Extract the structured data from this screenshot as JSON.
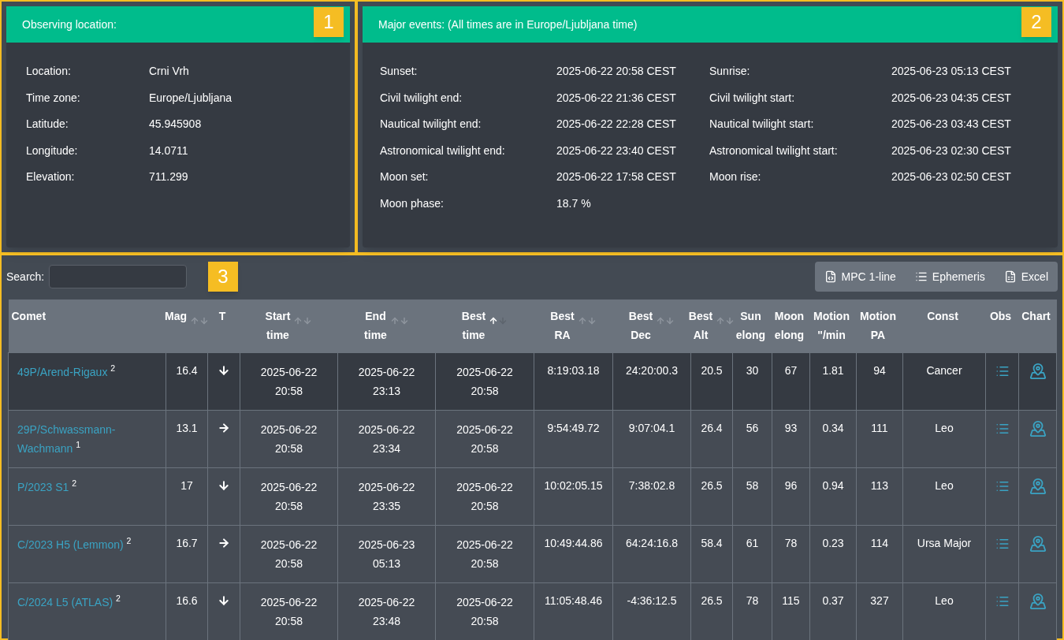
{
  "location_panel": {
    "title": "Observing location:",
    "badge": "1",
    "fields": [
      {
        "label": "Location:",
        "value": "Crni Vrh"
      },
      {
        "label": "Time zone:",
        "value": "Europe/Ljubljana"
      },
      {
        "label": "Latitude:",
        "value": "45.945908"
      },
      {
        "label": "Longitude:",
        "value": "14.0711"
      },
      {
        "label": "Elevation:",
        "value": "711.299"
      }
    ]
  },
  "events_panel": {
    "title": "Major events: (All times are in Europe/Ljubljana time)",
    "badge": "2",
    "rows": [
      {
        "label": "Sunset:",
        "value": "2025-06-22 20:58 CEST",
        "label_2": "Sunrise:",
        "value_2": "2025-06-23 05:13 CEST"
      },
      {
        "label": "Civil twilight end:",
        "value": "2025-06-22 21:36 CEST",
        "label_2": "Civil twilight start:",
        "value_2": "2025-06-23 04:35 CEST"
      },
      {
        "label": "Nautical twilight end:",
        "value": "2025-06-22 22:28 CEST",
        "label_2": "Nautical twilight start:",
        "value_2": "2025-06-23 03:43 CEST"
      },
      {
        "label": "Astronomical twilight end:",
        "value": "2025-06-22 23:40 CEST",
        "label_2": "Astronomical twilight start:",
        "value_2": "2025-06-23 02:30 CEST"
      },
      {
        "label": "Moon set:",
        "value": "2025-06-22 17:58 CEST",
        "label_2": "Moon rise:",
        "value_2": "2025-06-23 02:50 CEST"
      },
      {
        "label": "Moon phase:",
        "value": "18.7 %"
      }
    ]
  },
  "table_panel": {
    "badge": "3",
    "search": {
      "label": "Search:"
    },
    "exports": [
      {
        "kind": "code",
        "label": "MPC 1-line"
      },
      {
        "kind": "list",
        "label": "Ephemeris"
      },
      {
        "kind": "excel",
        "label": "Excel"
      }
    ],
    "columns": [
      {
        "label": "Comet"
      },
      {
        "label": "Mag",
        "sorted": false
      },
      {
        "label": "T"
      },
      {
        "label": "Start time",
        "sorted": false
      },
      {
        "label": "End time",
        "sorted": false
      },
      {
        "label": "Best time",
        "sorted": true
      },
      {
        "label": "Best RA",
        "sorted": false
      },
      {
        "label": "Best Dec",
        "sorted": false
      },
      {
        "label": "Best Alt",
        "sorted": false
      },
      {
        "label": "Sun elong"
      },
      {
        "label": "Moon elong"
      },
      {
        "label": "Motion \"/min"
      },
      {
        "label": "Motion PA"
      },
      {
        "label": "Const"
      },
      {
        "label": "Obs"
      },
      {
        "label": "Chart"
      }
    ],
    "rows": [
      {
        "highlighted": true,
        "comet": "49P/Arend-Rigaux $^{2}$",
        "mag": "16.4",
        "kind": "down",
        "start": [
          "2025-06-22",
          "20:58"
        ],
        "end": [
          "2025-06-22",
          "23:13"
        ],
        "best": [
          "2025-06-22",
          "20:58"
        ],
        "ra": "8:19:03.18",
        "dec": "24:20:00.3",
        "alt": "20.5",
        "sun": "30",
        "moon": "67",
        "motion": "1.81",
        "pa": "94",
        "const": "Cancer"
      },
      {
        "highlighted": false,
        "comet": "29P/Schwassmann-Wachmann $^{1}$",
        "mag": "13.1",
        "kind": "right",
        "start": [
          "2025-06-22",
          "20:58"
        ],
        "end": [
          "2025-06-22",
          "23:34"
        ],
        "best": [
          "2025-06-22",
          "20:58"
        ],
        "ra": "9:54:49.72",
        "dec": "9:07:04.1",
        "alt": "26.4",
        "sun": "56",
        "moon": "93",
        "motion": "0.34",
        "pa": "111",
        "const": "Leo"
      },
      {
        "highlighted": false,
        "comet": "P/2023 S1 $^{2}$",
        "mag": "17",
        "kind": "down",
        "start": [
          "2025-06-22",
          "20:58"
        ],
        "end": [
          "2025-06-22",
          "23:35"
        ],
        "best": [
          "2025-06-22",
          "20:58"
        ],
        "ra": "10:02:05.15",
        "dec": "7:38:02.8",
        "alt": "26.5",
        "sun": "58",
        "moon": "96",
        "motion": "0.94",
        "pa": "113",
        "const": "Leo"
      },
      {
        "highlighted": false,
        "comet": "C/2023 H5 (Lemmon) $^{2}$",
        "mag": "16.7",
        "kind": "right",
        "start": [
          "2025-06-22",
          "20:58"
        ],
        "end": [
          "2025-06-23",
          "05:13"
        ],
        "best": [
          "2025-06-22",
          "20:58"
        ],
        "ra": "10:49:44.86",
        "dec": "64:24:16.8",
        "alt": "58.4",
        "sun": "61",
        "moon": "78",
        "motion": "0.23",
        "pa": "114",
        "const": "Ursa Major"
      },
      {
        "highlighted": false,
        "comet": "C/2024 L5 (ATLAS) $^{2}$",
        "mag": "16.6",
        "kind": "down",
        "start": [
          "2025-06-22",
          "20:58"
        ],
        "end": [
          "2025-06-22",
          "23:48"
        ],
        "best": [
          "2025-06-22",
          "20:58"
        ],
        "ra": "11:05:48.46",
        "dec": "-4:36:12.5",
        "alt": "26.5",
        "sun": "78",
        "moon": "115",
        "motion": "0.37",
        "pa": "327",
        "const": "Leo"
      }
    ]
  }
}
